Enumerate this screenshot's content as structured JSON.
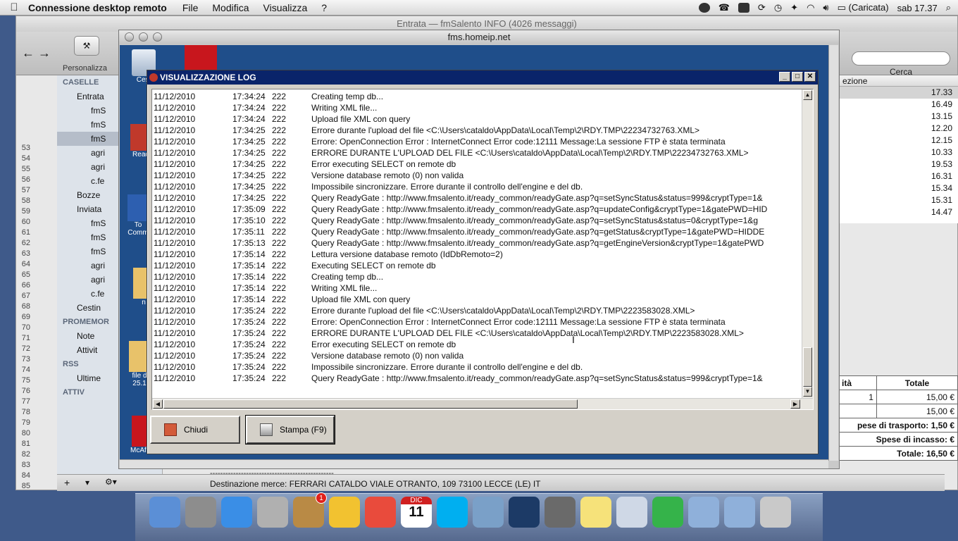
{
  "menubar": {
    "app": "Connessione desktop remoto",
    "items": [
      "File",
      "Modifica",
      "Visualizza",
      "?"
    ],
    "battery": "(Caricata)",
    "clock": "sab 17.37"
  },
  "mail": {
    "title": "Entrata — fmSalento INFO (4026 messaggi)",
    "personalizza": "Personalizza",
    "cerca": "Cerca",
    "sidebar": [
      {
        "label": "CASELLE",
        "head": true
      },
      {
        "label": "Entrata",
        "indent": 1
      },
      {
        "label": "fmS",
        "indent": 2
      },
      {
        "label": "fmS",
        "indent": 2
      },
      {
        "label": "fmS",
        "indent": 2,
        "selected": true
      },
      {
        "label": "agri",
        "indent": 2
      },
      {
        "label": "agri",
        "indent": 2
      },
      {
        "label": "c.fe",
        "indent": 2
      },
      {
        "label": "Bozze",
        "indent": 1
      },
      {
        "label": "Inviata",
        "indent": 1
      },
      {
        "label": "fmS",
        "indent": 2
      },
      {
        "label": "fmS",
        "indent": 2
      },
      {
        "label": "fmS",
        "indent": 2
      },
      {
        "label": "agri",
        "indent": 2
      },
      {
        "label": "agri",
        "indent": 2
      },
      {
        "label": "c.fe",
        "indent": 2
      },
      {
        "label": "Cestin",
        "indent": 1
      },
      {
        "label": "PROMEMOR",
        "head": true
      },
      {
        "label": "Note",
        "indent": 1
      },
      {
        "label": "Attivit",
        "indent": 1
      },
      {
        "label": "RSS",
        "head": true
      },
      {
        "label": "Ultime",
        "indent": 1
      },
      {
        "label": "ATTIV",
        "head": true
      }
    ],
    "line_numbers": [
      "53",
      "54",
      "55",
      "56",
      "57",
      "58",
      "59",
      "60",
      "61",
      "62",
      "63",
      "64",
      "65",
      "66",
      "67",
      "68",
      "69",
      "70",
      "71",
      "72",
      "73",
      "74",
      "75",
      "76",
      "77",
      "78",
      "79",
      "80",
      "81",
      "82",
      "83",
      "84",
      "85"
    ],
    "list_header": "ezione",
    "times": [
      "17.33",
      "16.49",
      "13.15",
      "12.20",
      "12.15",
      "10.33",
      "19.53",
      "16.31",
      "15.34",
      "15.31",
      "14.47"
    ],
    "order_table": [
      [
        "ità",
        "Totale"
      ],
      [
        "1",
        "15,00 €"
      ],
      [
        "",
        "15,00 €"
      ],
      [
        "pese di trasporto: 1,50 €",
        ""
      ],
      [
        "Spese di incasso:  €",
        ""
      ],
      [
        "Totale: 16,50 €",
        ""
      ]
    ],
    "dashes": "------------------------------------------------",
    "destination": "Destinazione merce: FERRARI CATALDO VIALE OTRANTO, 109 73100 LECCE (LE) IT"
  },
  "remote": {
    "title": "fms.homeip.net",
    "desktop_icons": [
      "Cest",
      "Read",
      "To Comm",
      "n",
      "file d 25.1",
      "McAfee"
    ]
  },
  "log_window": {
    "title": "VISUALIZZAZIONE LOG",
    "buttons": {
      "close": "Chiudi",
      "print": "Stampa (F9)"
    },
    "rows": [
      [
        "11/12/2010",
        "17:34:24",
        "222",
        "Creating temp db..."
      ],
      [
        "11/12/2010",
        "17:34:24",
        "222",
        "Writing XML file..."
      ],
      [
        "11/12/2010",
        "17:34:24",
        "222",
        "Upload file XML con query"
      ],
      [
        "11/12/2010",
        "17:34:25",
        "222",
        "Errore durante l'upload del file <C:\\Users\\cataldo\\AppData\\Local\\Temp\\2\\RDY.TMP\\22234732763.XML>"
      ],
      [
        "11/12/2010",
        "17:34:25",
        "222",
        "Errore: OpenConnection Error : InternetConnect Error code:12111 Message:La sessione FTP è stata terminata"
      ],
      [
        "11/12/2010",
        "17:34:25",
        "222",
        "ERRORE DURANTE L'UPLOAD DEL FILE <C:\\Users\\cataldo\\AppData\\Local\\Temp\\2\\RDY.TMP\\22234732763.XML>"
      ],
      [
        "11/12/2010",
        "17:34:25",
        "222",
        "Error executing SELECT on remote db"
      ],
      [
        "11/12/2010",
        "17:34:25",
        "222",
        "Versione database remoto (0) non valida"
      ],
      [
        "11/12/2010",
        "17:34:25",
        "222",
        "Impossibile sincronizzare. Errore durante il controllo dell'engine e del db."
      ],
      [
        "11/12/2010",
        "17:34:25",
        "222",
        "Query ReadyGate : http://www.fmsalento.it/ready_common/readyGate.asp?q=setSyncStatus&status=999&cryptType=1&"
      ],
      [
        "11/12/2010",
        "17:35:09",
        "222",
        "Query ReadyGate : http://www.fmsalento.it/ready_common/readyGate.asp?q=updateConfig&cryptType=1&gatePWD=HID"
      ],
      [
        "11/12/2010",
        "17:35:10",
        "222",
        "Query ReadyGate : http://www.fmsalento.it/ready_common/readyGate.asp?q=setSyncStatus&status=0&cryptType=1&g"
      ],
      [
        "11/12/2010",
        "17:35:11",
        "222",
        "Query ReadyGate : http://www.fmsalento.it/ready_common/readyGate.asp?q=getStatus&cryptType=1&gatePWD=HIDDE"
      ],
      [
        "11/12/2010",
        "17:35:13",
        "222",
        "Query ReadyGate : http://www.fmsalento.it/ready_common/readyGate.asp?q=getEngineVersion&cryptType=1&gatePWD"
      ],
      [
        "11/12/2010",
        "17:35:14",
        "222",
        "Lettura versione database remoto (IdDbRemoto=2)"
      ],
      [
        "11/12/2010",
        "17:35:14",
        "222",
        "Executing SELECT on remote db"
      ],
      [
        "11/12/2010",
        "17:35:14",
        "222",
        "Creating temp db..."
      ],
      [
        "11/12/2010",
        "17:35:14",
        "222",
        "Writing XML file..."
      ],
      [
        "11/12/2010",
        "17:35:14",
        "222",
        "Upload file XML con query"
      ],
      [
        "11/12/2010",
        "17:35:24",
        "222",
        "Errore durante l'upload del file <C:\\Users\\cataldo\\AppData\\Local\\Temp\\2\\RDY.TMP\\2223583028.XML>"
      ],
      [
        "11/12/2010",
        "17:35:24",
        "222",
        "Errore: OpenConnection Error : InternetConnect Error code:12111 Message:La sessione FTP è stata terminata"
      ],
      [
        "11/12/2010",
        "17:35:24",
        "222",
        "ERRORE DURANTE L'UPLOAD DEL FILE <C:\\Users\\cataldo\\AppData\\Local\\Temp\\2\\RDY.TMP\\2223583028.XML>"
      ],
      [
        "11/12/2010",
        "17:35:24",
        "222",
        "Error executing SELECT on remote db"
      ],
      [
        "11/12/2010",
        "17:35:24",
        "222",
        "Versione database remoto (0) non valida"
      ],
      [
        "11/12/2010",
        "17:35:24",
        "222",
        "Impossibile sincronizzare. Errore durante il controllo dell'engine e del db."
      ],
      [
        "11/12/2010",
        "17:35:24",
        "222",
        "Query ReadyGate : http://www.fmsalento.it/ready_common/readyGate.asp?q=setSyncStatus&status=999&cryptType=1&"
      ]
    ]
  },
  "dock": {
    "icons": [
      "finder-icon",
      "system-preferences-icon",
      "itunes-icon",
      "calculator-icon",
      "mail-icon",
      "cyberduck-icon",
      "chrome-icon",
      "ical-icon",
      "skype-icon",
      "iphoto-icon",
      "photoshop-icon",
      "photo-icon",
      "stickies-icon",
      "remote-desktop-icon",
      "crossover-icon",
      "applications-folder-icon",
      "downloads-folder-icon",
      "trash-icon"
    ],
    "ical_month": "DIC",
    "ical_day": "11",
    "mail_badge": "1"
  }
}
